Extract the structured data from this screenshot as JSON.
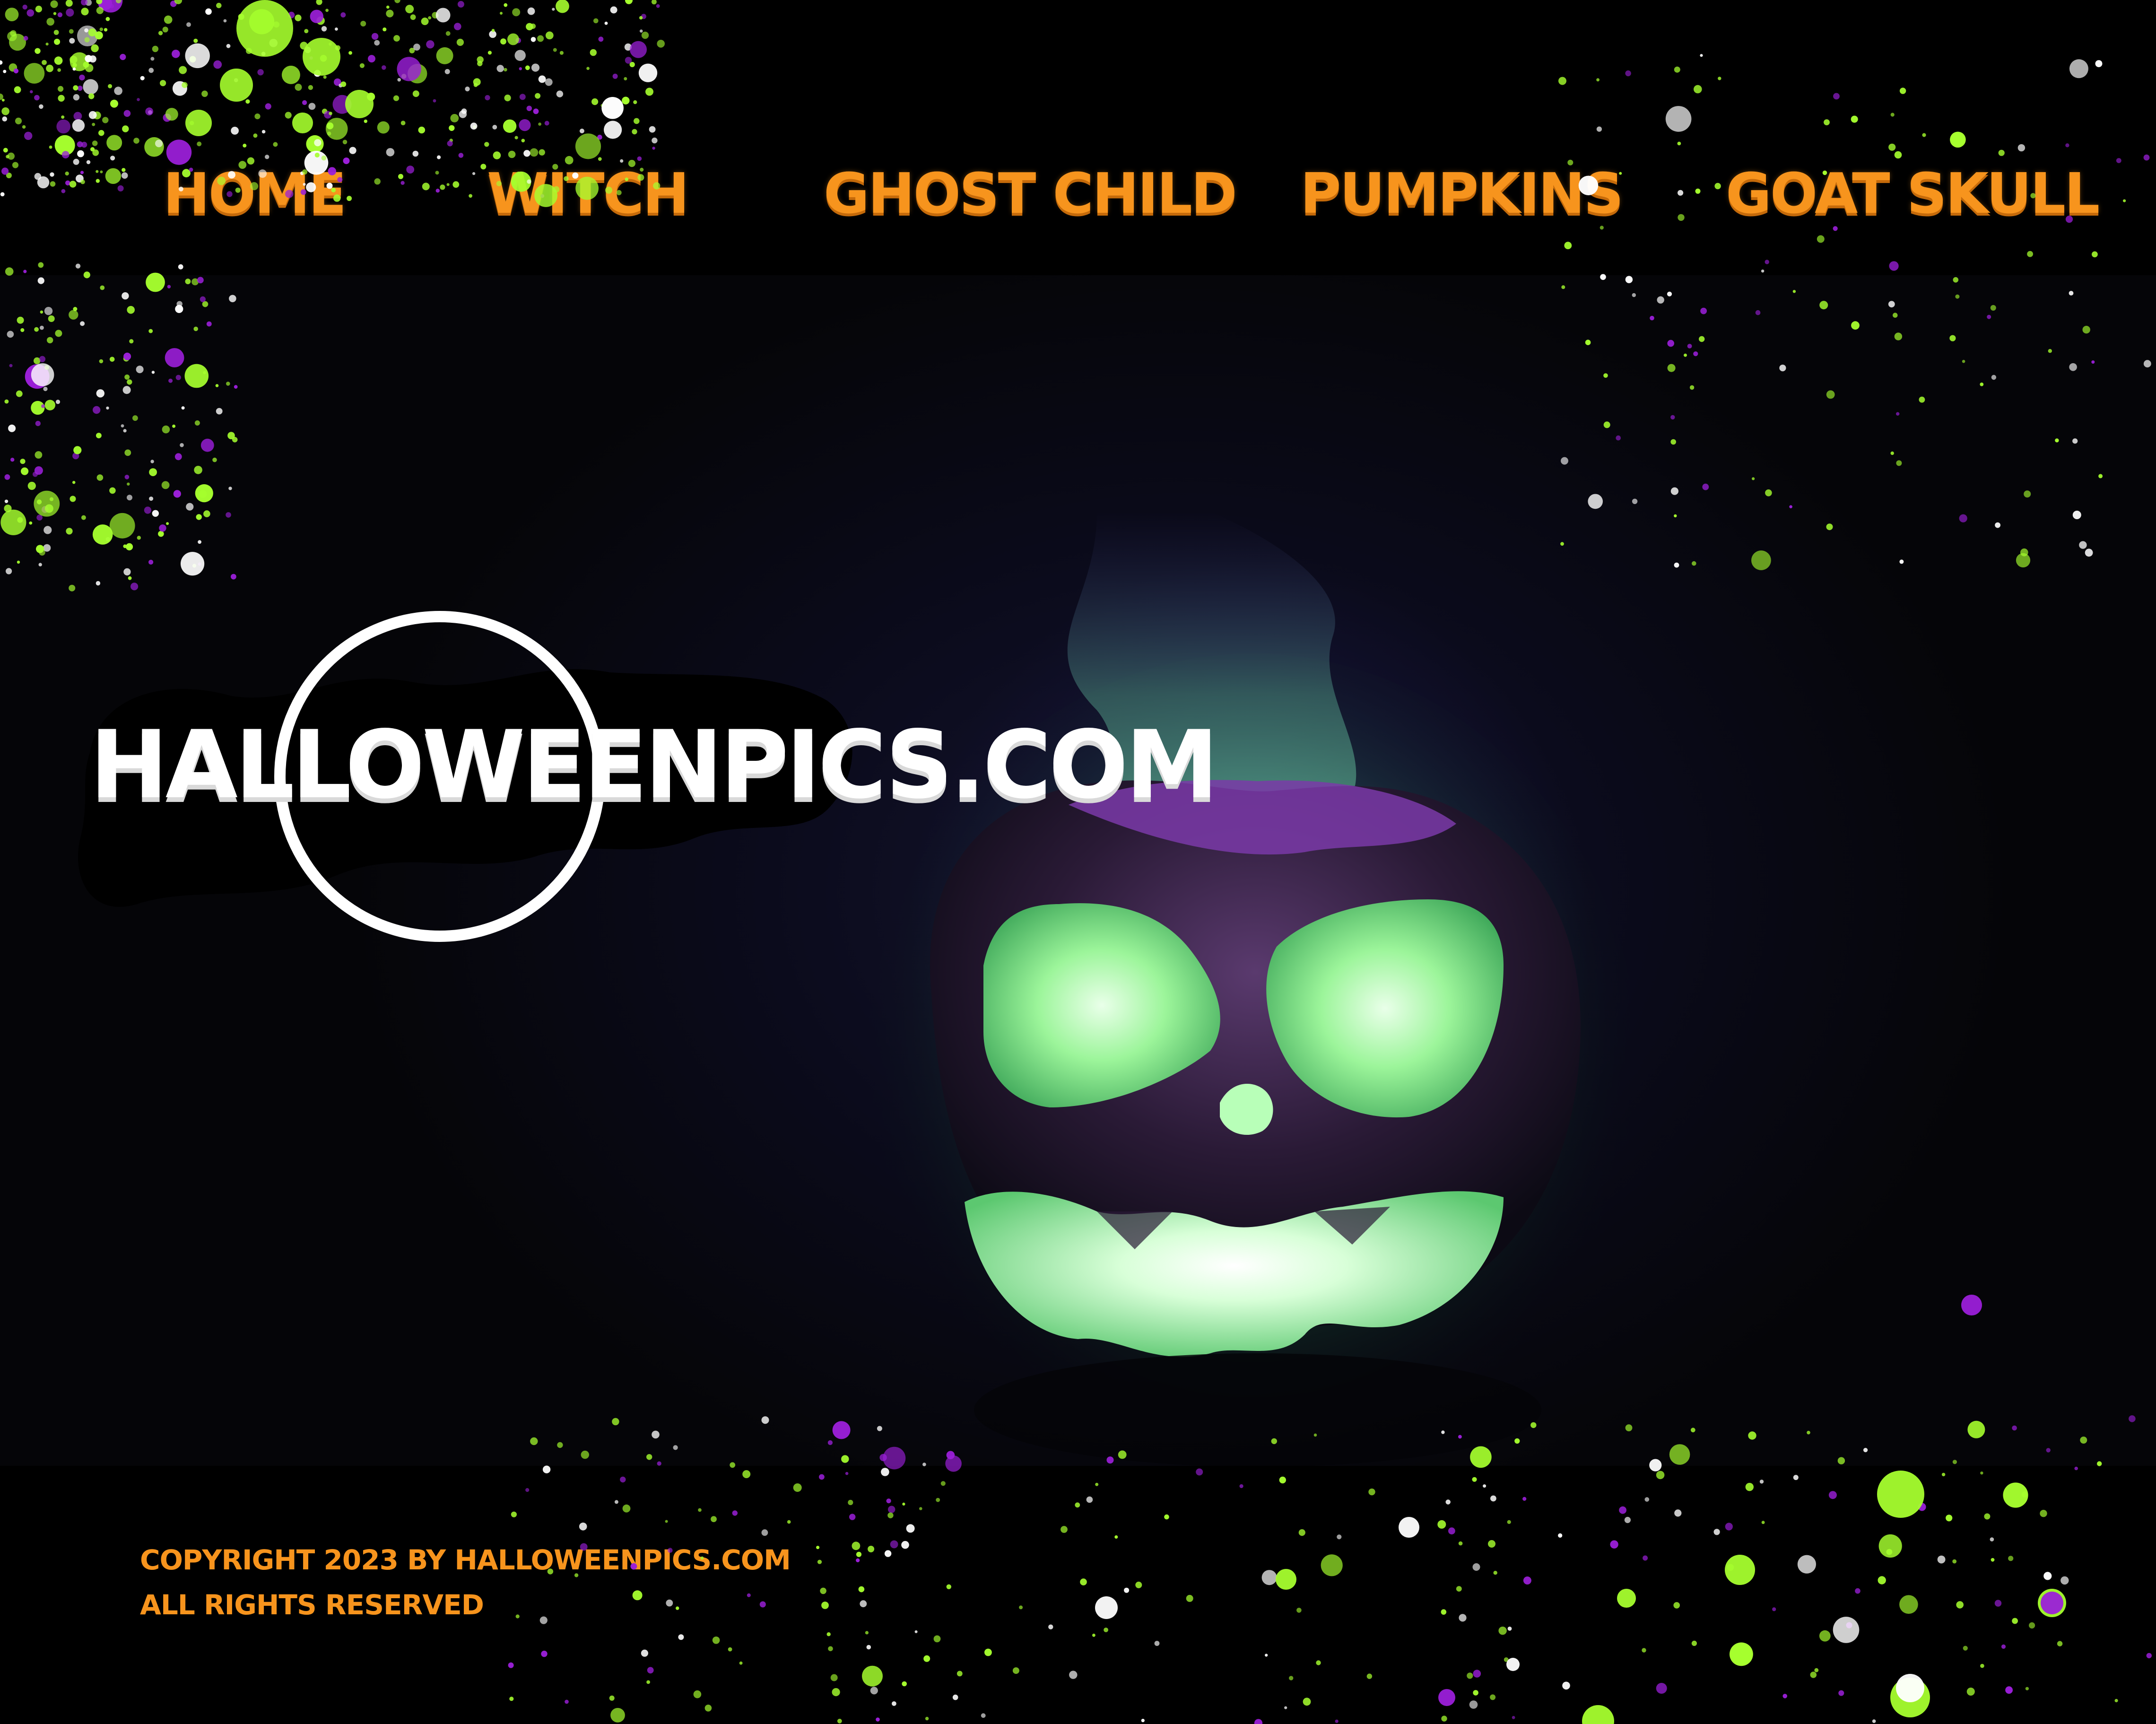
{
  "colors": {
    "accent_orange": "#f7941d",
    "neon_green": "#a6ff2e",
    "purple": "#9b1fd9",
    "background": "#000000"
  },
  "nav": {
    "items": [
      {
        "label": "HOME"
      },
      {
        "label": "WITCH"
      },
      {
        "label": "GHOST CHILD"
      },
      {
        "label": "PUMPKINS"
      },
      {
        "label": "GOAT SKULL"
      }
    ]
  },
  "logo": {
    "text": "HALLOWEENPICS.COM"
  },
  "hero": {
    "image_subject": "glowing-green-jack-o-lantern"
  },
  "footer": {
    "copyright": "COPYRIGHT 2023 BY HALLOWEENPICS.COM",
    "rights": "ALL RIGHTS RESERVED"
  }
}
